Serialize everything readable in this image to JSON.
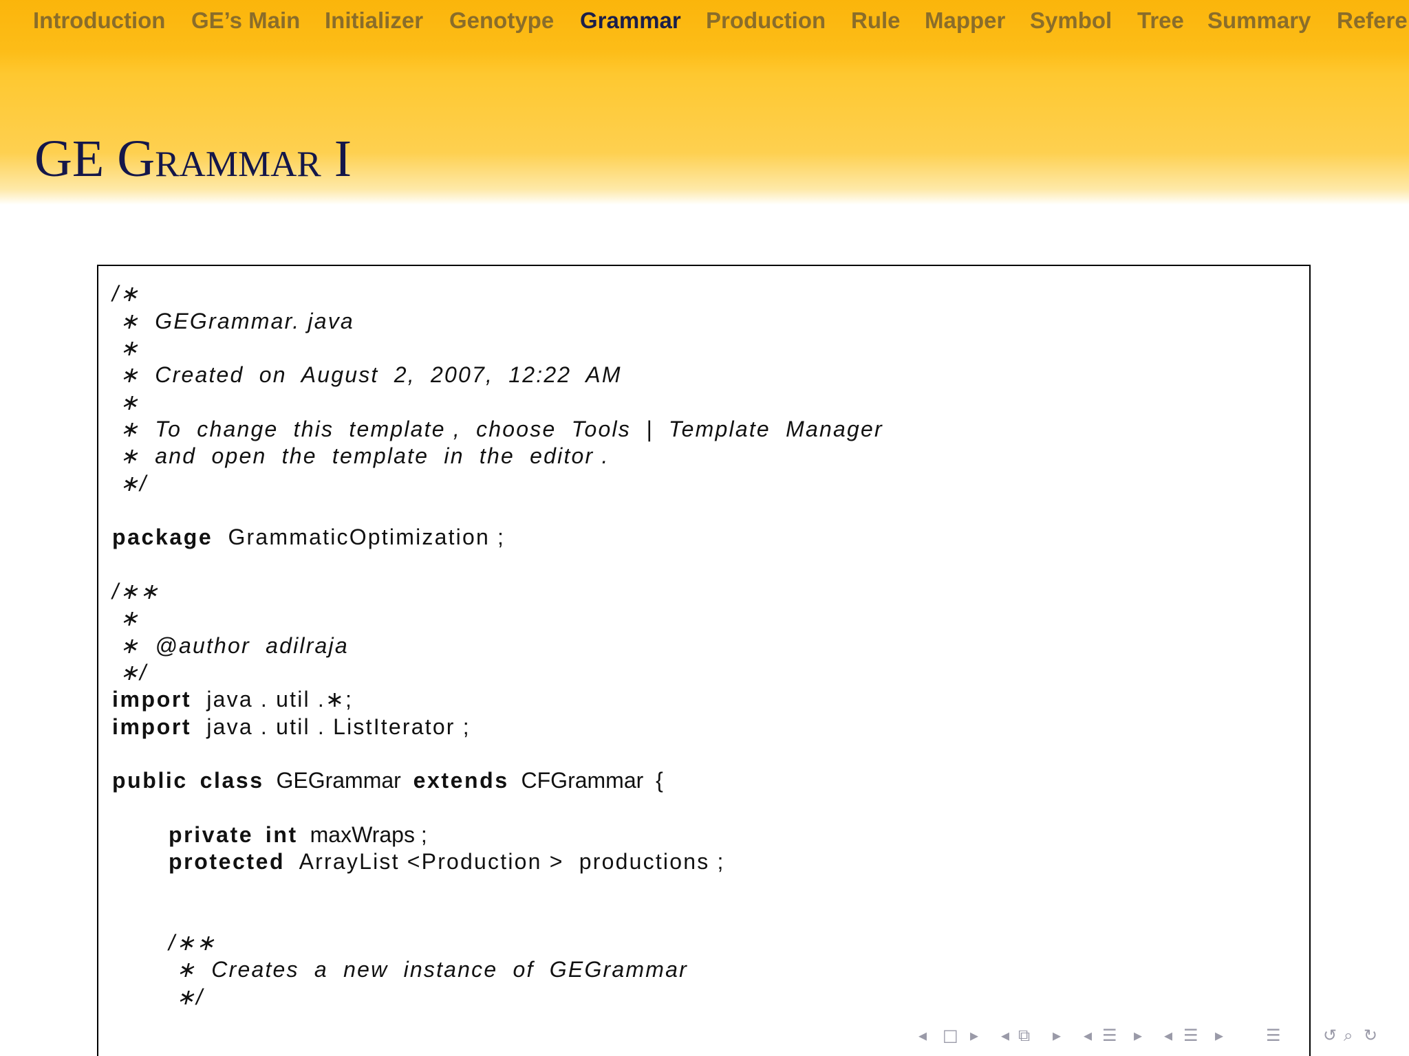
{
  "navbar": {
    "items": [
      {
        "label": "Introduction",
        "active": false
      },
      {
        "label": "GE’s Main",
        "active": false
      },
      {
        "label": "Initializer",
        "active": false
      },
      {
        "label": "Genotype",
        "active": false
      },
      {
        "label": "Grammar",
        "active": true
      },
      {
        "label": "Production",
        "active": false
      },
      {
        "label": "Rule",
        "active": false
      },
      {
        "label": "Mapper",
        "active": false
      },
      {
        "label": "Symbol",
        "active": false
      },
      {
        "label": "Tree",
        "active": false
      },
      {
        "label": "Summary",
        "active": false
      },
      {
        "label": "Refere",
        "active": false
      }
    ]
  },
  "slide": {
    "title_word1": "GE G",
    "title_word1_sc": "rammar",
    "title_suffix": " I"
  },
  "code": {
    "lines": [
      "/∗",
      " ∗  GEGrammar. java",
      " ∗",
      " ∗  Created  on  August  2,  2007,  12:22  AM",
      " ∗",
      " ∗  To  change  this  template ,  choose  Tools  |  Template  Manager",
      " ∗  and  open  the  template  in  the  editor .",
      " ∗/",
      "",
      "GrammaticOptimization ;",
      "",
      "/∗∗",
      " ∗",
      " ∗  @author  adilraja",
      " ∗/",
      "java . util .∗;",
      "java . util . ListIterator ;",
      "",
      "GEGrammar",
      "",
      "maxWraps ;",
      "ArrayList <Production >  productions ;",
      "",
      "",
      "/∗∗",
      " ∗  Creates  a  new  instance  of  GEGrammar",
      " ∗/"
    ],
    "keywords": {
      "package": "package",
      "import": "import",
      "public": "public",
      "class": "class",
      "extends": "extends",
      "private": "private",
      "int": "int",
      "protected": "protected"
    },
    "cfgrammar": "CFGrammar  {"
  },
  "nav_symbols": {
    "icons": [
      "arrow-left-icon",
      "frame-icon",
      "arrow-right-icon",
      "arrow-left-icon",
      "subsection-icon",
      "arrow-right-icon",
      "arrow-left-icon",
      "section-icon",
      "arrow-right-icon",
      "arrow-left-icon",
      "document-icon",
      "arrow-right-icon",
      "appendix-icon",
      "back-icon",
      "search-icon",
      "forward-icon"
    ]
  }
}
